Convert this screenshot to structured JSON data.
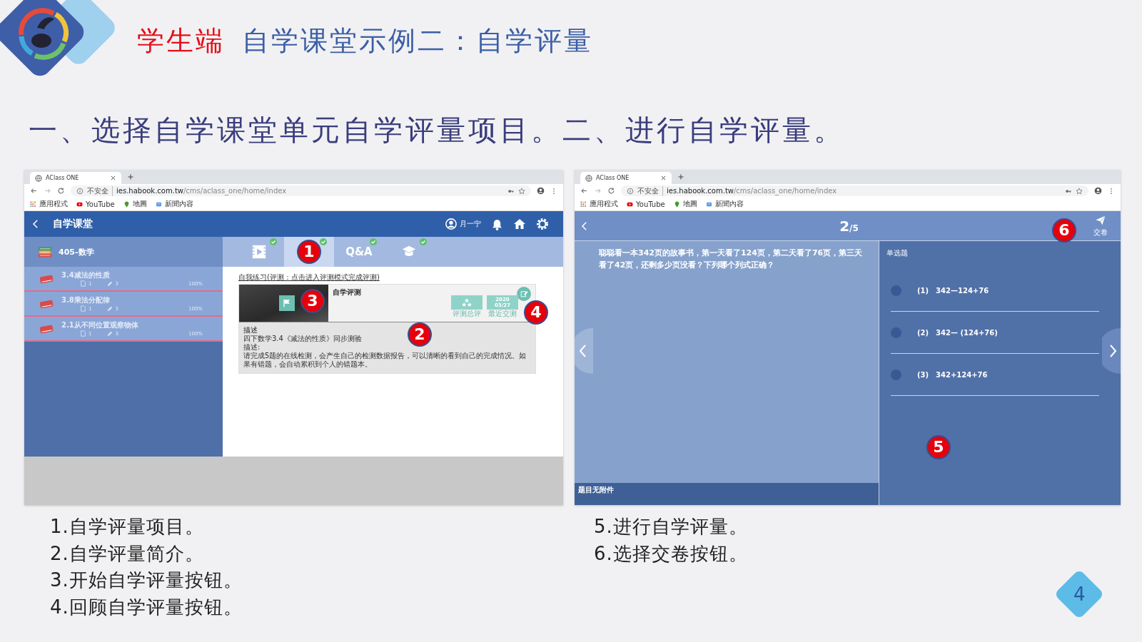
{
  "header": {
    "highlight": "学生端",
    "title": "自学课堂示例二：自学评量"
  },
  "heading": "一、选择自学课堂单元自学评量项目。二、进行自学评量。",
  "left_screen": {
    "browser": {
      "tab_title": "AClass ONE",
      "security": "不安全",
      "url_host": "ies.habook.com.tw",
      "url_path": "/cms/aclass_one/home/index",
      "bookmarks": [
        {
          "kind": "apps",
          "label": "應用程式"
        },
        {
          "kind": "youtube",
          "label": "YouTube"
        },
        {
          "kind": "maps",
          "label": "地圖"
        },
        {
          "kind": "news",
          "label": "新聞內容"
        }
      ]
    },
    "app": {
      "title": "自学课堂",
      "user": "月一宁",
      "course": "405-数学",
      "units": [
        {
          "title": "3.4减法的性质",
          "files": "1",
          "edits": "3",
          "progress": "100%"
        },
        {
          "title": "3.8乘法分配律",
          "files": "1",
          "edits": "3",
          "progress": "100%"
        },
        {
          "title": "2.1从不同位置观察物体",
          "files": "1",
          "edits": "3",
          "progress": "100%"
        }
      ],
      "tabs": [
        {
          "kind": "video",
          "selected": false,
          "done": true
        },
        {
          "kind": "test",
          "selected": true,
          "done": true,
          "marker": "1"
        },
        {
          "kind": "qa",
          "label": "Q&A",
          "selected": false,
          "done": true
        },
        {
          "kind": "course",
          "selected": false,
          "done": true
        }
      ],
      "section_label": "自我练习(评测：点击进入评测模式完成评测)",
      "card": {
        "title": "自学评测",
        "start_marker": "3",
        "review_marker": "4",
        "stats": [
          {
            "kind": "stars",
            "label": "评测总评"
          },
          {
            "kind": "date",
            "value_lines": [
              "2020",
              "03/27"
            ],
            "label": "最近交测"
          }
        ]
      },
      "description": {
        "marker": "2",
        "lines": [
          "描述",
          "四下数学3.4《减法的性质》同步测验",
          "描述:",
          "请完成5题的在线检测，会产生自己的检测数据报告，可以清晰的看到自己的完成情况。如果有错题，会自动累积到个人的错题本。"
        ]
      }
    }
  },
  "right_screen": {
    "browser": {
      "tab_title": "AClass ONE",
      "security": "不安全",
      "url_host": "ies.habook.com.tw",
      "url_path": "/cms/aclass_one/home/index",
      "bookmarks": [
        {
          "kind": "apps",
          "label": "應用程式"
        },
        {
          "kind": "youtube",
          "label": "YouTube"
        },
        {
          "kind": "maps",
          "label": "地圖"
        },
        {
          "kind": "news",
          "label": "新聞內容"
        }
      ]
    },
    "exam": {
      "current": "2",
      "total": "/5",
      "submit": {
        "label": "交卷",
        "marker": "6"
      },
      "question": "聪聪看一本342页的故事书，第一天看了124页，第二天看了76页，第三天看了42页，还剩多少页没看？下列哪个列式正确？",
      "footer": "题目无附件",
      "type_label": "单选题",
      "marker": "5",
      "options": [
        {
          "label": "(1)",
          "text": "342—124+76",
          "selected": false
        },
        {
          "label": "(2)",
          "text": "342— (124+76)",
          "selected": false
        },
        {
          "label": "(3)",
          "text": "342+124+76",
          "selected": false
        }
      ]
    }
  },
  "captions_left": [
    "1.自学评量项目。",
    "2.自学评量简介。",
    "3.开始自学评量按钮。",
    "4.回顾自学评量按钮。"
  ],
  "captions_right": [
    "5.进行自学评量。",
    "6.选择交卷按钮。"
  ],
  "page_number": "4"
}
